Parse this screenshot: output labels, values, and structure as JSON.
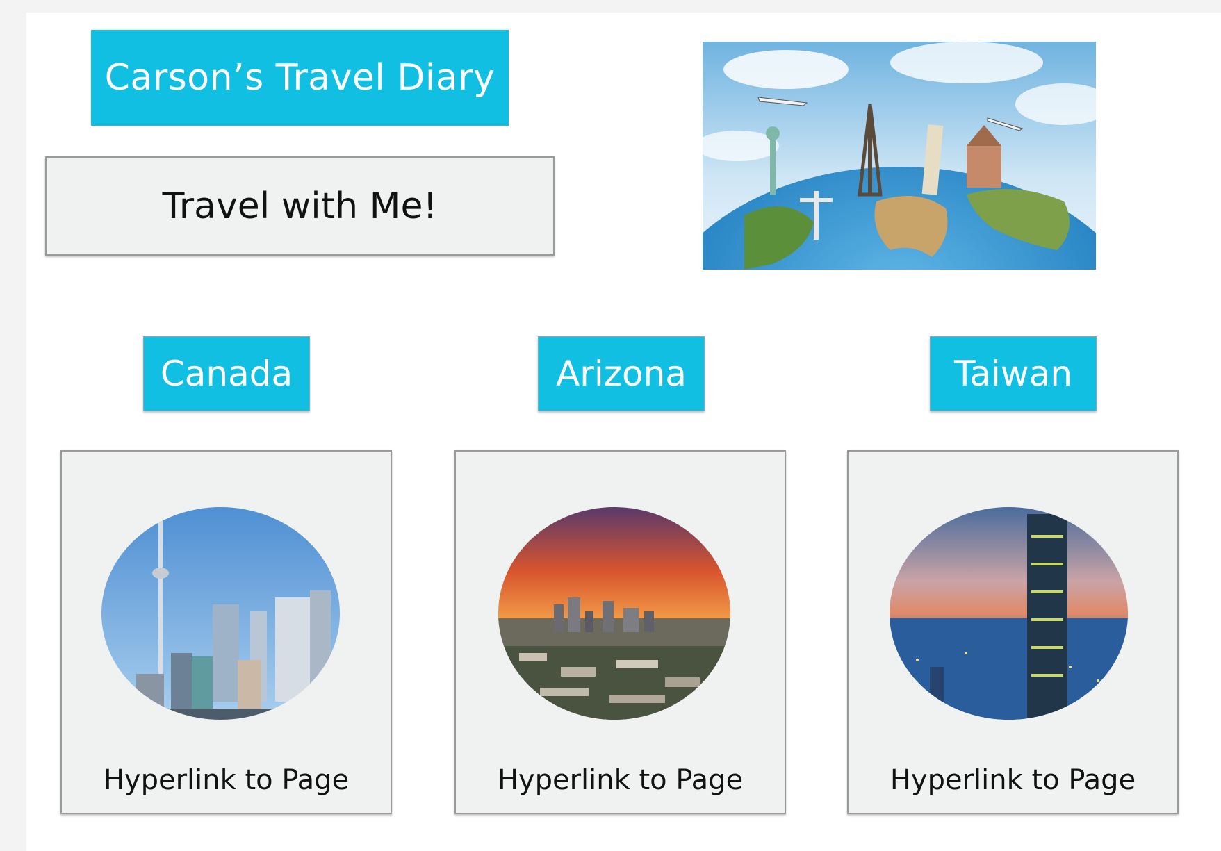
{
  "header": {
    "title": "Carson’s Travel Diary",
    "tagline": "Travel with Me!"
  },
  "hero_image": {
    "description_icon": "world-landmarks-globe-image"
  },
  "destinations": [
    {
      "label": "Canada",
      "link_text": "Hyperlink to Page",
      "photo_icon": "toronto-skyline-photo"
    },
    {
      "label": "Arizona",
      "link_text": "Hyperlink to Page",
      "photo_icon": "phoenix-sunset-photo"
    },
    {
      "label": "Taiwan",
      "link_text": "Hyperlink to Page",
      "photo_icon": "taipei-101-photo"
    }
  ],
  "colors": {
    "accent": "#11bfe3",
    "card_bg": "#f0f2f1",
    "border": "#9a9a9a"
  }
}
